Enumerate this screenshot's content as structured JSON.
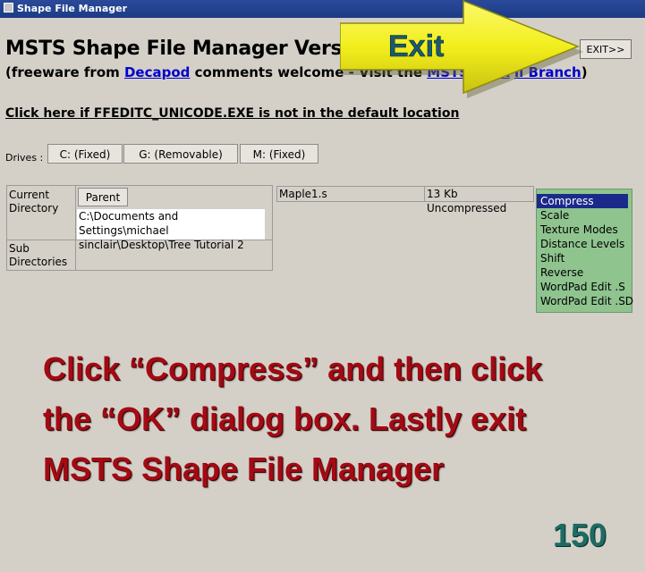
{
  "window": {
    "title": "Shape File Manager"
  },
  "header": {
    "title": "MSTS Shape File Manager Versio",
    "exit_button": "EXIT>>",
    "subtitle_prefix": "(freeware from ",
    "subtitle_link": "Decapod",
    "subtitle_middle": " comments welcome - Visit the ",
    "subtitle_link2": "MSTS GWK",
    "subtitle_link3": "ll Branch",
    "subtitle_suffix": ")",
    "location_link": "Click here if FFEDITC_UNICODE.EXE is not in the default location"
  },
  "drives": {
    "label": "Drives :",
    "items": [
      {
        "label": "C: (Fixed)"
      },
      {
        "label": "G: (Removable)"
      },
      {
        "label": "M: (Fixed)"
      }
    ]
  },
  "directory": {
    "current_label_1": "Current",
    "current_label_2": "Directory",
    "parent_button": "Parent",
    "path_line1": "C:\\Documents and Settings\\michael",
    "path_line2": "sinclair\\Desktop\\Tree Tutorial 2",
    "sub_label_1": "Sub",
    "sub_label_2": "Directories"
  },
  "file": {
    "name": "Maple1.s",
    "info": "13 Kb Uncompressed"
  },
  "context_menu": {
    "items": [
      {
        "label": "Compress"
      },
      {
        "label": "Scale"
      },
      {
        "label": "Texture Modes"
      },
      {
        "label": "Distance Levels"
      },
      {
        "label": "Shift"
      },
      {
        "label": "Reverse"
      },
      {
        "label": "WordPad Edit .S"
      },
      {
        "label": "WordPad Edit .SD"
      }
    ],
    "selected_color": "#1b2a8a",
    "background_color": "#8fc48f"
  },
  "overlay": {
    "arrow_label": "Exit",
    "arrow_color": "#f2ee1c",
    "instruction_line1": "Click “Compress” and then click",
    "instruction_line2": "the “OK” dialog box. Lastly exit",
    "instruction_line3": "MSTS Shape File Manager",
    "instruction_color": "#a30a14",
    "slide_number": "150"
  }
}
